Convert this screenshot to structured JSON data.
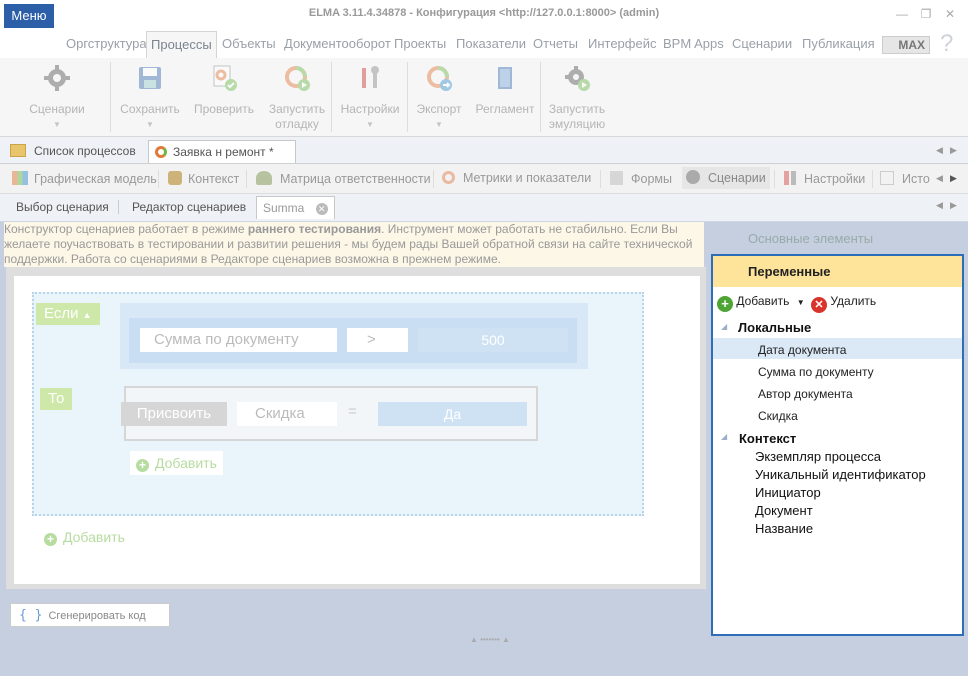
{
  "window": {
    "title": "ELMA 3.11.4.34878 - Конфигурация <http://127.0.0.1:8000> (admin)",
    "minimize": "—",
    "maximize": "❐",
    "close": "✕"
  },
  "menu": {
    "menu_label": "Меню",
    "tabs": [
      "Оргструктура",
      "Процессы",
      "Объекты",
      "Документооборот",
      "Проекты",
      "Показатели",
      "Отчеты",
      "Интерфейс",
      "BPM Apps",
      "Сценарии",
      "Публикация"
    ],
    "active_tab": "Процессы",
    "max_label": "MAX",
    "help": "?"
  },
  "ribbon": {
    "scenarios": "Сценарии",
    "save": "Сохранить",
    "check": "Проверить",
    "debug_line1": "Запустить",
    "debug_line2": "отладку",
    "settings": "Настройки",
    "export": "Экспорт",
    "regulation": "Регламент",
    "emulate_line1": "Запустить",
    "emulate_line2": "эмуляцию"
  },
  "doc_tabs": {
    "list": "Список процессов",
    "active": "Заявка н ремонт *"
  },
  "sub_tabs": [
    "Графическая модель",
    "Контекст",
    "Матрица ответственности",
    "Метрики и показатели",
    "Формы",
    "Сценарии",
    "Настройки",
    "Исто"
  ],
  "sub_tab_active": "Сценарии",
  "scenario_tabs": {
    "select": "Выбор сценария",
    "editor": "Редактор сценариев",
    "active": "Summa"
  },
  "warning": {
    "part1": "Конструктор сценариев работает в режиме ",
    "bold": "раннего тестирования",
    "part2": ". Инструмент может работать не стабильно. Если Вы желаете поучаствовать в тестировании и развитии решения - мы будем рады Вашей обратной связи на сайте технической поддержки. Работа со сценариями в Редакторе сценариев возможна в прежнем режиме."
  },
  "editor": {
    "if_label": "Если",
    "condition": {
      "field": "Сумма по документу",
      "operator": ">",
      "value": "500"
    },
    "then_label": "То",
    "assign": {
      "action": "Присвоить",
      "field": "Скидка",
      "equals": "=",
      "value": "Да"
    },
    "add_inner": "Добавить",
    "add_outer": "Добавить",
    "generate": "Сгенерировать код"
  },
  "right_panel": {
    "basic": "Основные элементы",
    "header": "Переменные",
    "add": "Добавить",
    "delete": "Удалить",
    "local": "Локальные",
    "local_items": [
      "Дата документа",
      "Сумма по документу",
      "Автор документа",
      "Скидка"
    ],
    "context": "Контекст",
    "context_items": [
      "Экземпляр процесса",
      "Уникальный идентификатор",
      "Инициатор",
      "Документ",
      "Название"
    ]
  }
}
